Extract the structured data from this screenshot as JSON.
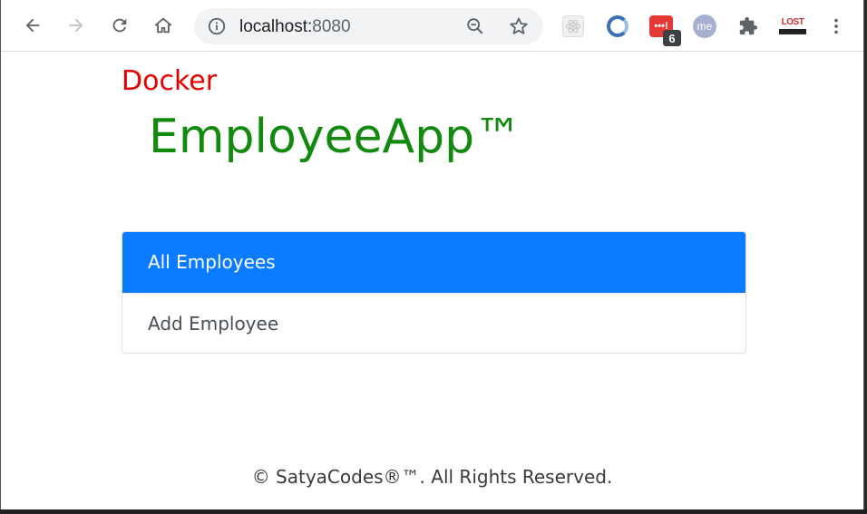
{
  "browser": {
    "url_host": "localhost:",
    "url_port": "8080",
    "ext_mail_label": "•••!",
    "ext_badge_count": "6",
    "ext_me_label": "me",
    "ext_lost_label": "LOST"
  },
  "page": {
    "brand": "Docker",
    "app_title": "EmployeeApp™",
    "nav": [
      {
        "label": "All Employees",
        "active": true
      },
      {
        "label": "Add Employee",
        "active": false
      }
    ],
    "footer": "© SatyaCodes®™. All Rights Reserved."
  },
  "colors": {
    "brand": "#e60000",
    "title": "#118a0e",
    "active_item": "#0b7bff"
  }
}
